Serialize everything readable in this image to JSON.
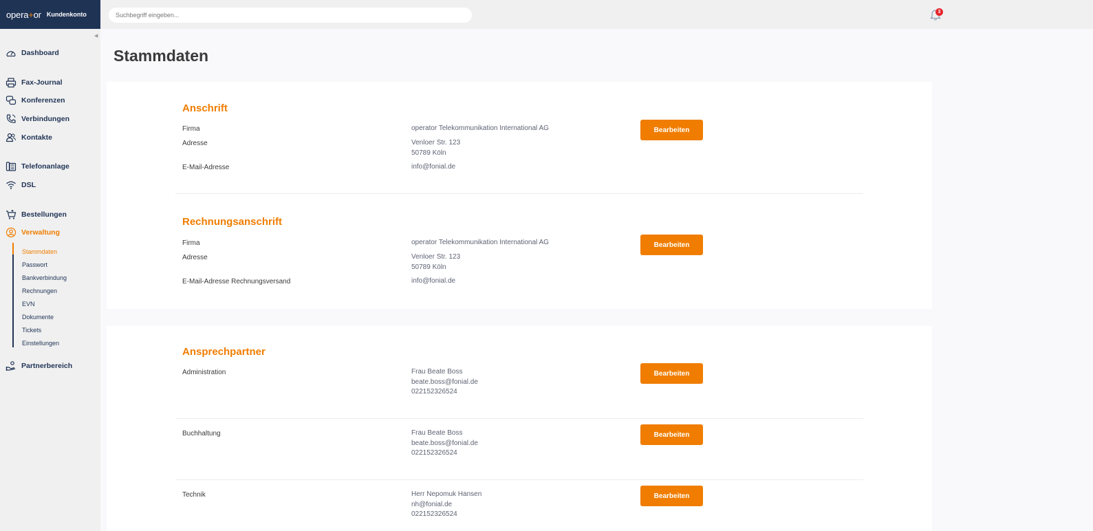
{
  "brand": {
    "logo_pre": "opera",
    "logo_plus": "+",
    "logo_post": "or",
    "account_label": "Kundenkonto"
  },
  "header": {
    "search_placeholder": "Suchbegriff eingeben...",
    "notification_count": "3"
  },
  "sidebar": {
    "items": [
      {
        "label": "Dashboard",
        "icon": "speedometer-icon"
      },
      {
        "label": "Fax-Journal",
        "icon": "printer-icon"
      },
      {
        "label": "Konferenzen",
        "icon": "conference-icon"
      },
      {
        "label": "Verbindungen",
        "icon": "phone-icon"
      },
      {
        "label": "Kontakte",
        "icon": "contacts-icon"
      },
      {
        "label": "Telefonanlage",
        "icon": "phone-system-icon"
      },
      {
        "label": "DSL",
        "icon": "wifi-icon"
      },
      {
        "label": "Bestellungen",
        "icon": "cart-icon"
      },
      {
        "label": "Verwaltung",
        "icon": "user-circle-icon"
      },
      {
        "label": "Partnerbereich",
        "icon": "partner-icon"
      }
    ],
    "sub_items": [
      "Stammdaten",
      "Passwort",
      "Bankverbindung",
      "Rechnungen",
      "EVN",
      "Dokumente",
      "Tickets",
      "Einstellungen"
    ]
  },
  "page": {
    "title": "Stammdaten"
  },
  "button_label": "Bearbeiten",
  "anschrift": {
    "title": "Anschrift",
    "firma_label": "Firma",
    "firma_value": "operator Telekommunikation International AG",
    "adresse_label": "Adresse",
    "adresse_line1": "Venloer Str. 123",
    "adresse_line2": "50789 Köln",
    "email_label": "E-Mail-Adresse",
    "email_value": "info@fonial.de"
  },
  "rechnungsanschrift": {
    "title": "Rechnungsanschrift",
    "firma_label": "Firma",
    "firma_value": "operator Telekommunikation International AG",
    "adresse_label": "Adresse",
    "adresse_line1": "Venloer Str. 123",
    "adresse_line2": "50789 Köln",
    "email_label": "E-Mail-Adresse Rechnungsversand",
    "email_value": "info@fonial.de"
  },
  "ansprechpartner": {
    "title": "Ansprechpartner",
    "contacts": [
      {
        "role": "Administration",
        "name": "Frau Beate Boss",
        "email": "beate.boss@fonial.de",
        "phone": "022152326524"
      },
      {
        "role": "Buchhaltung",
        "name": "Frau Beate Boss",
        "email": "beate.boss@fonial.de",
        "phone": "022152326524"
      },
      {
        "role": "Technik",
        "name": "Herr Nepomuk Hansen",
        "email": "nh@fonial.de",
        "phone": "022152326524"
      }
    ]
  },
  "colors": {
    "accent": "#f07d00",
    "navy": "#1f3355",
    "badge": "#e8232a"
  }
}
